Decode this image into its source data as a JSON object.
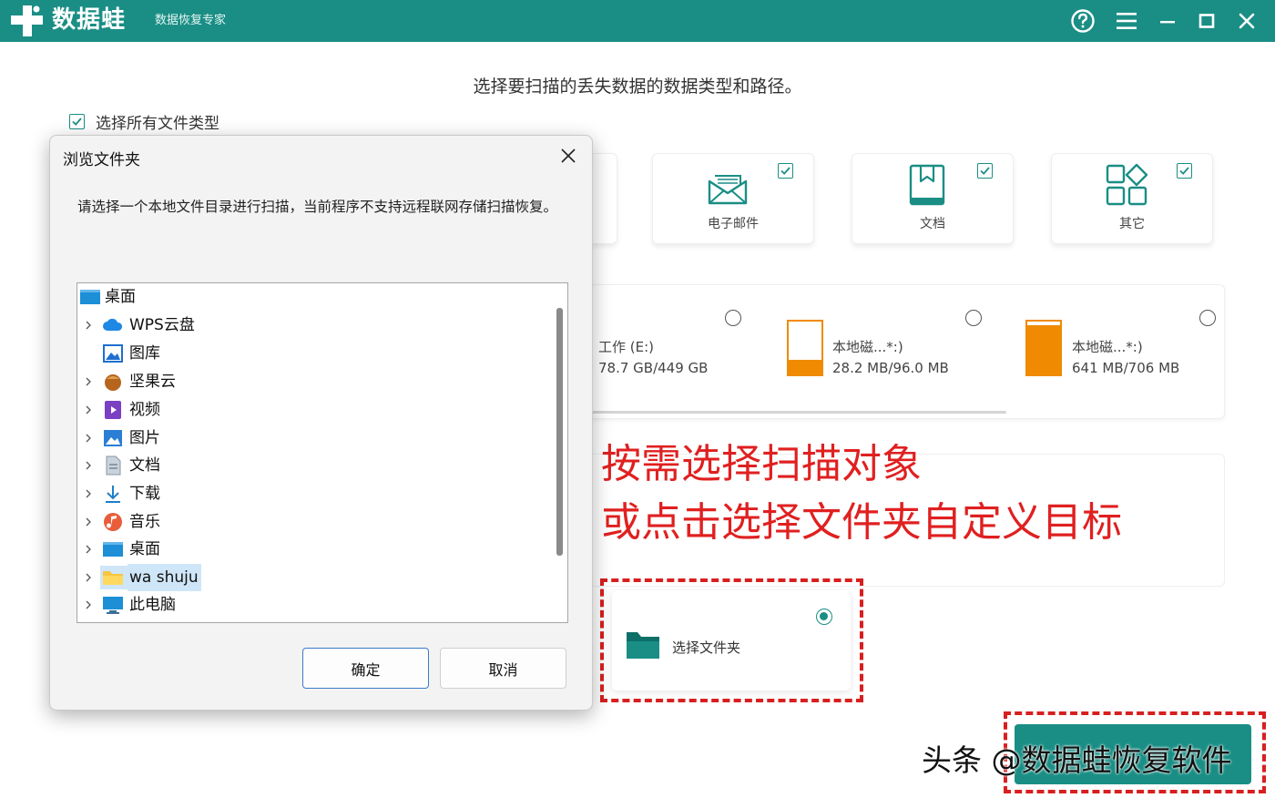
{
  "app": {
    "name": "数据蛙",
    "subtitle": "数据恢复专家"
  },
  "colors": {
    "brand": "#1a8e85",
    "annotation_red": "#e02020",
    "drive_fill": "#f08a00"
  },
  "main": {
    "instruction": "选择要扫描的丢失数据的数据类型和路径。",
    "select_all_label": "选择所有文件类型",
    "file_types": [
      {
        "label": "电子邮件",
        "icon": "email-icon",
        "checked": true
      },
      {
        "label": "文档",
        "icon": "document-icon",
        "checked": true
      },
      {
        "label": "其它",
        "icon": "other-icon",
        "checked": true
      }
    ],
    "drives": [
      {
        "name": "工作 (E:)",
        "size": "78.7 GB/449 GB",
        "fill": 0.18
      },
      {
        "name": "本地磁...*:)",
        "size": "28.2 MB/96.0 MB",
        "fill": 0.29
      },
      {
        "name": "本地磁...*:)",
        "size": "641 MB/706 MB",
        "fill": 0.91
      }
    ],
    "annotation_line1": "按需选择扫描对象",
    "annotation_line2": "或点击选择文件夹自定义目标",
    "folder_card_label": "选择文件夹"
  },
  "watermark": "头条 @数据蛙恢复软件",
  "dialog": {
    "title": "浏览文件夹",
    "message": "请选择一个本地文件目录进行扫描，当前程序不支持远程联网存储扫描恢复。",
    "tree": [
      {
        "label": "桌面",
        "icon": "desktop-icon",
        "root": true
      },
      {
        "label": "WPS云盘",
        "icon": "cloud-icon"
      },
      {
        "label": "图库",
        "icon": "gallery-icon"
      },
      {
        "label": "坚果云",
        "icon": "nut-cloud-icon"
      },
      {
        "label": "视频",
        "icon": "video-icon"
      },
      {
        "label": "图片",
        "icon": "pictures-icon"
      },
      {
        "label": "文档",
        "icon": "documents-icon"
      },
      {
        "label": "下载",
        "icon": "download-icon"
      },
      {
        "label": "音乐",
        "icon": "music-icon"
      },
      {
        "label": "桌面",
        "icon": "desktop-icon"
      },
      {
        "label": "wa shuju",
        "icon": "folder-icon",
        "selected": true
      },
      {
        "label": "此电脑",
        "icon": "this-pc-icon"
      }
    ],
    "ok_label": "确定",
    "cancel_label": "取消"
  }
}
